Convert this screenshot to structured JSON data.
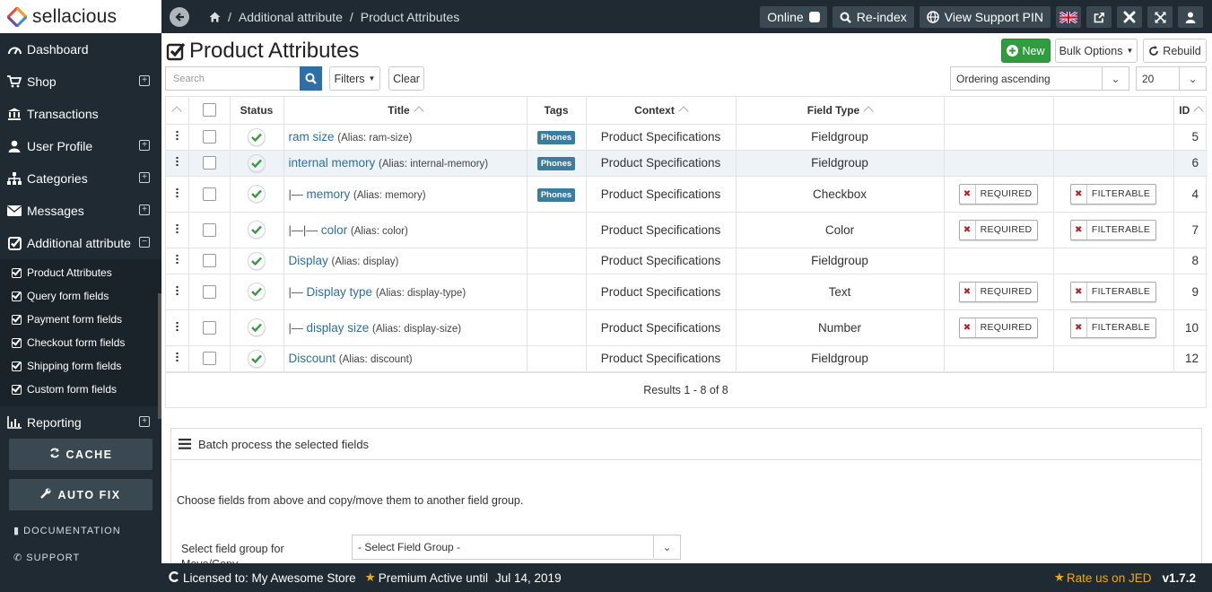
{
  "brand": {
    "name": "sellacious"
  },
  "sidebar": {
    "items": [
      {
        "label": "Dashboard",
        "expandable": false
      },
      {
        "label": "Shop",
        "expandable": true
      },
      {
        "label": "Transactions",
        "expandable": false
      },
      {
        "label": "User Profile",
        "expandable": true
      },
      {
        "label": "Categories",
        "expandable": true
      },
      {
        "label": "Messages",
        "expandable": true
      },
      {
        "label": "Additional attribute",
        "expandable": true,
        "expanded": true
      },
      {
        "label": "Reporting",
        "expandable": true
      }
    ],
    "subitems": [
      "Product Attributes",
      "Query form fields",
      "Payment form fields",
      "Checkout form fields",
      "Shipping form fields",
      "Custom form fields"
    ],
    "cache_label": "CACHE",
    "autofix_label": "AUTO FIX",
    "documentation_label": "DOCUMENTATION",
    "support_label": "SUPPORT"
  },
  "topbar": {
    "breadcrumb": [
      "Additional attribute",
      "Product Attributes"
    ],
    "online_label": "Online",
    "reindex_label": "Re-index",
    "support_pin_label": "View Support PIN"
  },
  "page": {
    "title": "Product Attributes"
  },
  "toolbar": {
    "new_label": "New",
    "bulk_label": "Bulk Options",
    "rebuild_label": "Rebuild",
    "search_placeholder": "Search",
    "filters_label": "Filters",
    "clear_label": "Clear",
    "ordering_value": "Ordering ascending",
    "limit_value": "20"
  },
  "table": {
    "headers": {
      "status": "Status",
      "title": "Title",
      "tags": "Tags",
      "context": "Context",
      "field_type": "Field Type",
      "id": "ID"
    },
    "rows": [
      {
        "prefix": "",
        "title": "ram size",
        "alias": "(Alias: ram-size)",
        "tag": "Phones",
        "context": "Product Specifications",
        "type": "Fieldgroup",
        "required": "",
        "filterable": "",
        "id": "5"
      },
      {
        "prefix": "",
        "title": "internal memory",
        "alias": "(Alias: internal-memory)",
        "tag": "Phones",
        "context": "Product Specifications",
        "type": "Fieldgroup",
        "required": "",
        "filterable": "",
        "id": "6"
      },
      {
        "prefix": "|— ",
        "title": "memory",
        "alias": "(Alias: memory)",
        "tag": "Phones",
        "context": "Product Specifications",
        "type": "Checkbox",
        "required": "REQUIRED",
        "filterable": "FILTERABLE",
        "id": "4"
      },
      {
        "prefix": "|—|— ",
        "title": "color",
        "alias": "(Alias: color)",
        "tag": "",
        "context": "Product Specifications",
        "type": "Color",
        "required": "REQUIRED",
        "filterable": "FILTERABLE",
        "id": "7"
      },
      {
        "prefix": "",
        "title": "Display",
        "alias": "(Alias: display)",
        "tag": "",
        "context": "Product Specifications",
        "type": "Fieldgroup",
        "required": "",
        "filterable": "",
        "id": "8"
      },
      {
        "prefix": "|— ",
        "title": "Display type",
        "alias": "(Alias: display-type)",
        "tag": "",
        "context": "Product Specifications",
        "type": "Text",
        "required": "REQUIRED",
        "filterable": "FILTERABLE",
        "id": "9"
      },
      {
        "prefix": "|— ",
        "title": "display size",
        "alias": "(Alias: display-size)",
        "tag": "",
        "context": "Product Specifications",
        "type": "Number",
        "required": "REQUIRED",
        "filterable": "FILTERABLE",
        "id": "10"
      },
      {
        "prefix": "",
        "title": "Discount",
        "alias": "(Alias: discount)",
        "tag": "",
        "context": "Product Specifications",
        "type": "Fieldgroup",
        "required": "",
        "filterable": "",
        "id": "12"
      }
    ],
    "results": "Results 1 - 8 of 8"
  },
  "batch": {
    "title": "Batch process the selected fields",
    "description": "Choose fields from above and copy/move them to another field group.",
    "select_label": "Select field group for Move/Copy",
    "select_value": "- Select Field Group -"
  },
  "footer": {
    "licensed": "Licensed to: My Awesome Store",
    "premium": "Premium Active until",
    "date": "Jul 14, 2019",
    "rate": "Rate us on JED",
    "version": "v1.7.2"
  },
  "colors": {
    "sidebar_bg": "#1f2a32",
    "accent_green": "#2e9c3f",
    "link_blue": "#2d6ea3",
    "tag_blue": "#3c7c9e",
    "star": "#f0a91e"
  }
}
